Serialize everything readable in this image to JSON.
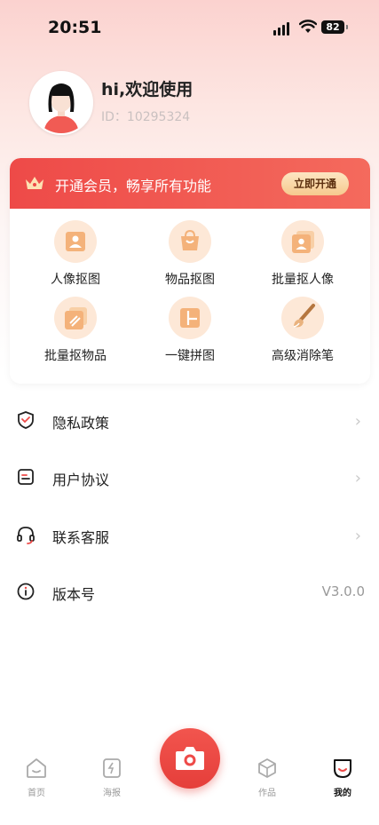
{
  "status_bar": {
    "time": "20:51",
    "battery": "82"
  },
  "profile": {
    "greeting": "hi,欢迎使用",
    "user_id": "ID：10295324"
  },
  "member": {
    "banner_text": "开通会员，畅享所有功能",
    "button_label": "立即开通"
  },
  "features": [
    {
      "label": "人像抠图",
      "icon": "portrait-icon"
    },
    {
      "label": "物品抠图",
      "icon": "bag-icon"
    },
    {
      "label": "批量抠人像",
      "icon": "batch-portrait-icon"
    },
    {
      "label": "批量抠物品",
      "icon": "batch-object-icon"
    },
    {
      "label": "一键拼图",
      "icon": "collage-icon"
    },
    {
      "label": "高级消除笔",
      "icon": "brush-icon"
    }
  ],
  "menu": [
    {
      "label": "隐私政策",
      "icon": "shield-icon"
    },
    {
      "label": "用户协议",
      "icon": "document-icon"
    },
    {
      "label": "联系客服",
      "icon": "headset-icon"
    },
    {
      "label": "版本号",
      "icon": "info-icon",
      "value": "V3.0.0"
    }
  ],
  "nav": {
    "home": "首页",
    "poster": "海报",
    "works": "作品",
    "mine": "我的"
  },
  "colors": {
    "accent": "#ee4a48",
    "feature_bg": "#fde8d7",
    "feature_fg": "#f0a060"
  }
}
